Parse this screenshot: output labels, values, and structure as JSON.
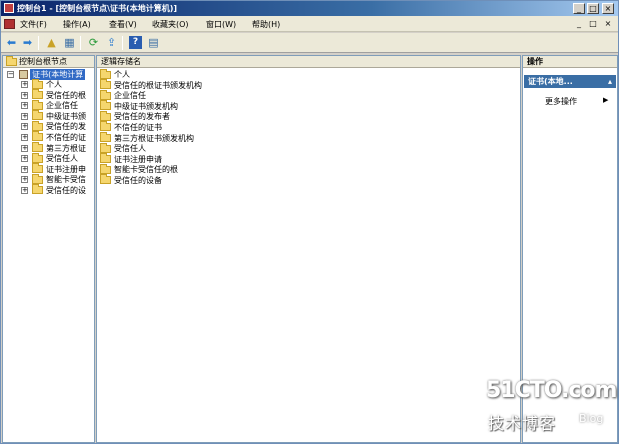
{
  "window": {
    "title": "控制台1 - [控制台根节点\\证书(本地计算机)]",
    "minimize": "_",
    "restore": "□",
    "close": "×"
  },
  "menubar": {
    "items": [
      "文件(F)",
      "操作(A)",
      "查看(V)",
      "收藏夹(O)",
      "窗口(W)",
      "帮助(H)"
    ],
    "doc_minimize": "_",
    "doc_restore": "□",
    "doc_close": "×"
  },
  "toolbar": {
    "back_icon": "back-arrow-icon",
    "forward_icon": "forward-arrow-icon",
    "glyphs": {
      "back": "⬅",
      "forward": "➡",
      "up": "▲",
      "console": "▦",
      "refresh": "⟳",
      "export": "⇪",
      "help": "?",
      "properties": "▤"
    }
  },
  "left_pane": {
    "header": "控制台根节点",
    "root": {
      "label": "证书(本地计算",
      "expander": "−"
    },
    "items": [
      "个人",
      "受信任的根",
      "企业信任",
      "中级证书颁",
      "受信任的发",
      "不信任的证",
      "第三方根证",
      "受信任人",
      "证书注册申",
      "智能卡受信",
      "受信任的设"
    ],
    "expander": "+"
  },
  "center_pane": {
    "header": "逻辑存储名",
    "items": [
      "个人",
      "受信任的根证书颁发机构",
      "企业信任",
      "中级证书颁发机构",
      "受信任的发布者",
      "不信任的证书",
      "第三方根证书颁发机构",
      "受信任人",
      "证书注册申请",
      "智能卡受信任的根",
      "受信任的设备"
    ]
  },
  "right_pane": {
    "header": "操作",
    "section_title": "证书(本地...",
    "section_caret": "▴",
    "more_actions": "更多操作",
    "more_arrow": "▶"
  },
  "watermark": {
    "main": "51CTO.com",
    "sub": "技术博客",
    "blog": "Blog"
  },
  "colors": {
    "title_gradient_start": "#0a246a",
    "selection": "#316ac5",
    "action_header": "#3a6ea5",
    "folder": "#f5d66e"
  }
}
